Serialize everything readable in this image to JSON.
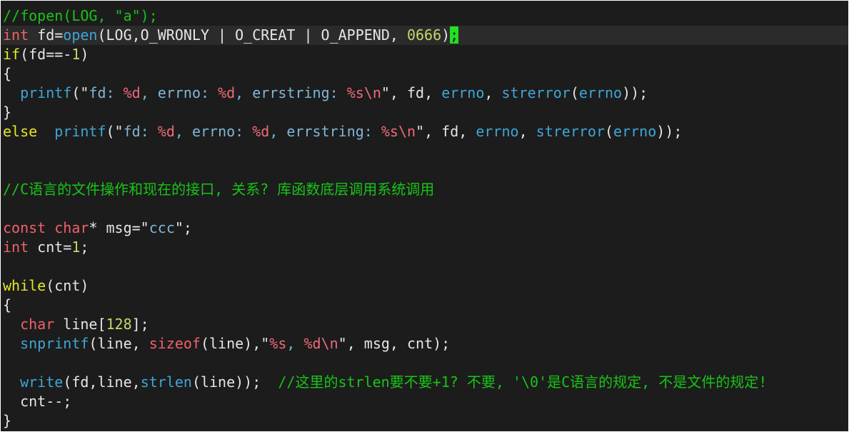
{
  "editor": {
    "colors": {
      "background": "#1c1c1c",
      "comment": "#18c418",
      "keyword_type": "#f0616a",
      "keyword_control": "#e6e62a",
      "function": "#3fa6d6",
      "number": "#c6d66a",
      "cursor": "#22e022"
    },
    "current_line": 1,
    "lines": [
      [
        [
          "//fopen(LOG, \"a\");",
          "com"
        ]
      ],
      [
        [
          "int",
          "type"
        ],
        [
          " fd=",
          "plain"
        ],
        [
          "open",
          "fn"
        ],
        [
          "(LOG,O_WRONLY | O_CREAT | O_APPEND, ",
          "plain"
        ],
        [
          "0666",
          "num"
        ],
        [
          ")",
          "plain"
        ],
        [
          ";",
          "cursor"
        ]
      ],
      [
        [
          "if",
          "ctrl"
        ],
        [
          "(fd==-",
          "plain"
        ],
        [
          "1",
          "num"
        ],
        [
          ")",
          "plain"
        ]
      ],
      [
        [
          "{",
          "plain"
        ]
      ],
      [
        [
          "  ",
          "plain"
        ],
        [
          "printf",
          "fn"
        ],
        [
          "(\"",
          "plain"
        ],
        [
          "fd: ",
          "str"
        ],
        [
          "%d",
          "fmt"
        ],
        [
          ", errno: ",
          "str"
        ],
        [
          "%d",
          "fmt"
        ],
        [
          ", errstring: ",
          "str"
        ],
        [
          "%s\\n",
          "fmt"
        ],
        [
          "\", fd, ",
          "plain"
        ],
        [
          "errno",
          "fn"
        ],
        [
          ", ",
          "plain"
        ],
        [
          "strerror",
          "fn"
        ],
        [
          "(",
          "plain"
        ],
        [
          "errno",
          "fn"
        ],
        [
          "));",
          "plain"
        ]
      ],
      [
        [
          "}",
          "plain"
        ]
      ],
      [
        [
          "else",
          "ctrl"
        ],
        [
          "  ",
          "plain"
        ],
        [
          "printf",
          "fn"
        ],
        [
          "(\"",
          "plain"
        ],
        [
          "fd: ",
          "str"
        ],
        [
          "%d",
          "fmt"
        ],
        [
          ", errno: ",
          "str"
        ],
        [
          "%d",
          "fmt"
        ],
        [
          ", errstring: ",
          "str"
        ],
        [
          "%s\\n",
          "fmt"
        ],
        [
          "\", fd, ",
          "plain"
        ],
        [
          "errno",
          "fn"
        ],
        [
          ", ",
          "plain"
        ],
        [
          "strerror",
          "fn"
        ],
        [
          "(",
          "plain"
        ],
        [
          "errno",
          "fn"
        ],
        [
          "));",
          "plain"
        ]
      ],
      [],
      [],
      [
        [
          "//C语言的文件操作和现在的接口, 关系? 库函数底层调用系统调用",
          "com"
        ]
      ],
      [],
      [
        [
          "const",
          "type"
        ],
        [
          " ",
          "plain"
        ],
        [
          "char",
          "type"
        ],
        [
          "* msg=\"",
          "plain"
        ],
        [
          "ccc",
          "str"
        ],
        [
          "\";",
          "plain"
        ]
      ],
      [
        [
          "int",
          "type"
        ],
        [
          " cnt=",
          "plain"
        ],
        [
          "1",
          "num"
        ],
        [
          ";",
          "plain"
        ]
      ],
      [],
      [
        [
          "while",
          "ctrl"
        ],
        [
          "(cnt)",
          "plain"
        ]
      ],
      [
        [
          "{",
          "plain"
        ]
      ],
      [
        [
          "  ",
          "plain"
        ],
        [
          "char",
          "type"
        ],
        [
          " line[",
          "plain"
        ],
        [
          "128",
          "num"
        ],
        [
          "];",
          "plain"
        ]
      ],
      [
        [
          "  ",
          "plain"
        ],
        [
          "snprintf",
          "fn"
        ],
        [
          "(line, ",
          "plain"
        ],
        [
          "sizeof",
          "type"
        ],
        [
          "(line),\"",
          "plain"
        ],
        [
          "%s",
          "fmt"
        ],
        [
          ", ",
          "str"
        ],
        [
          "%d\\n",
          "fmt"
        ],
        [
          "\", msg, cnt);",
          "plain"
        ]
      ],
      [],
      [
        [
          "  ",
          "plain"
        ],
        [
          "write",
          "fn"
        ],
        [
          "(fd,line,",
          "plain"
        ],
        [
          "strlen",
          "fn"
        ],
        [
          "(line));  ",
          "plain"
        ],
        [
          "//这里的strlen要不要+1? 不要, '\\0'是C语言的规定, 不是文件的规定!",
          "com"
        ]
      ],
      [
        [
          "  cnt--;",
          "plain"
        ]
      ],
      [
        [
          "}",
          "plain"
        ]
      ]
    ]
  }
}
